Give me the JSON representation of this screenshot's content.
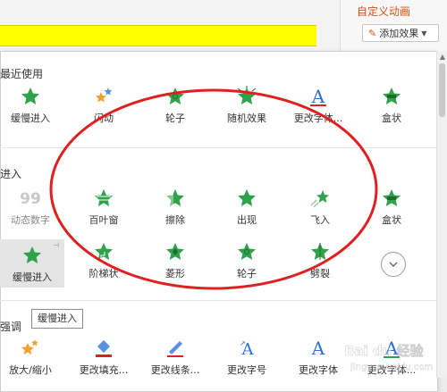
{
  "task_pane": {
    "title": "自定义动画",
    "add_effect_label": "添加效果",
    "add_effect_icon": "pencil-icon",
    "caret_icon": "chevron-down-icon"
  },
  "colors": {
    "star_green": "#2fa24a",
    "accent_red": "#e02020",
    "accent_blue": "#2e6fd6",
    "title_orange": "#d0521b",
    "highlight_yellow": "#ffff00"
  },
  "sections": {
    "recent": {
      "title": "最近使用",
      "items": [
        {
          "label": "缓慢进入",
          "icon": "green-star-icon"
        },
        {
          "label": "闪动",
          "icon": "multicolor-stars-icon"
        },
        {
          "label": "轮子",
          "icon": "green-star-wheel-icon"
        },
        {
          "label": "随机效果",
          "icon": "green-star-burst-icon"
        },
        {
          "label": "更改字体...",
          "icon": "font-A-icon"
        },
        {
          "label": "盒状",
          "icon": "green-box-star-icon"
        }
      ]
    },
    "entrance": {
      "title": "进入",
      "items": [
        {
          "label": "动态数字",
          "icon": "number-99-icon"
        },
        {
          "label": "百叶窗",
          "icon": "green-star-blinds-icon"
        },
        {
          "label": "擦除",
          "icon": "green-star-wipe-icon"
        },
        {
          "label": "出现",
          "icon": "green-star-appear-icon"
        },
        {
          "label": "飞入",
          "icon": "green-star-fly-icon"
        },
        {
          "label": "盒状",
          "icon": "green-box-star-icon"
        },
        {
          "label": "缓慢进入",
          "icon": "green-star-icon"
        },
        {
          "label": "阶梯状",
          "icon": "green-star-steps-icon"
        },
        {
          "label": "菱形",
          "icon": "green-star-diamond-icon"
        },
        {
          "label": "轮子",
          "icon": "green-star-wheel-icon"
        },
        {
          "label": "劈裂",
          "icon": "green-star-split-icon"
        }
      ]
    },
    "emphasis": {
      "title": "强调",
      "tooltip": "缓慢进入",
      "items": [
        {
          "label": "放大/缩小",
          "icon": "grow-shrink-icon"
        },
        {
          "label": "更改填充...",
          "icon": "fill-bucket-icon"
        },
        {
          "label": "更改线条...",
          "icon": "line-pen-icon"
        },
        {
          "label": "更改字号",
          "icon": "font-size-icon"
        },
        {
          "label": "更改字体",
          "icon": "font-A-icon"
        },
        {
          "label": "更改字体...",
          "icon": "font-color-icon"
        }
      ]
    }
  },
  "watermark": {
    "text": "Bai du 经验",
    "url": "jingyan.baidu.com"
  }
}
